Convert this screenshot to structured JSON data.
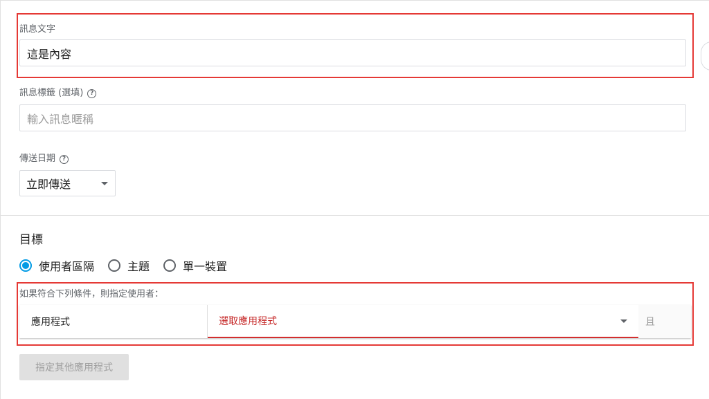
{
  "message": {
    "text_label": "訊息文字",
    "text_value": "這是內容",
    "tag_label": "訊息標籤 (選填)",
    "tag_placeholder": "輸入訊息暱稱",
    "send_date_label": "傳送日期",
    "send_date_value": "立即傳送"
  },
  "target": {
    "title": "目標",
    "options": [
      "使用者區隔",
      "主題",
      "單一裝置"
    ],
    "selected_option": "使用者區隔",
    "condition_label": "如果符合下列條件，則指定使用者：",
    "condition_field": "應用程式",
    "condition_select": "選取應用程式",
    "condition_and": "且",
    "add_app_button": "指定其他應用程式"
  },
  "colors": {
    "highlight": "#e53935",
    "radio_selected": "#039be5",
    "select_error": "#c62828"
  },
  "icons": {
    "help": "help-circle-icon",
    "dropdown": "caret-down-icon"
  }
}
